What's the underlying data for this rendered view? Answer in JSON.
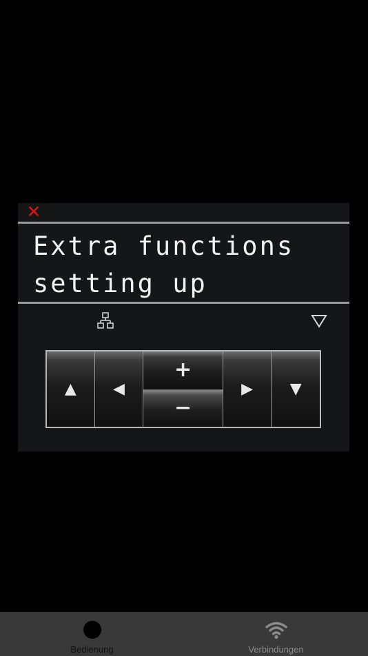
{
  "panel": {
    "close_glyph": "✕",
    "title": "Extra functions\nsetting up"
  },
  "icons": {
    "close": "close-icon",
    "tree": "network-tree-icon",
    "dropdown": "triangle-down-outline-icon"
  },
  "keypad": {
    "up": "▲",
    "left": "◀",
    "plus": "+",
    "minus": "−",
    "right": "▶",
    "down": "▼"
  },
  "tabbar": {
    "tabs": [
      {
        "label": "Bedienung",
        "icon": "circle-icon",
        "active": true
      },
      {
        "label": "Verbindungen",
        "icon": "wifi-icon",
        "active": false
      }
    ]
  },
  "colors": {
    "close": "#e01414",
    "panel_bg": "#151617",
    "tabbar_bg": "#393939",
    "text": "#f2f2f2"
  }
}
